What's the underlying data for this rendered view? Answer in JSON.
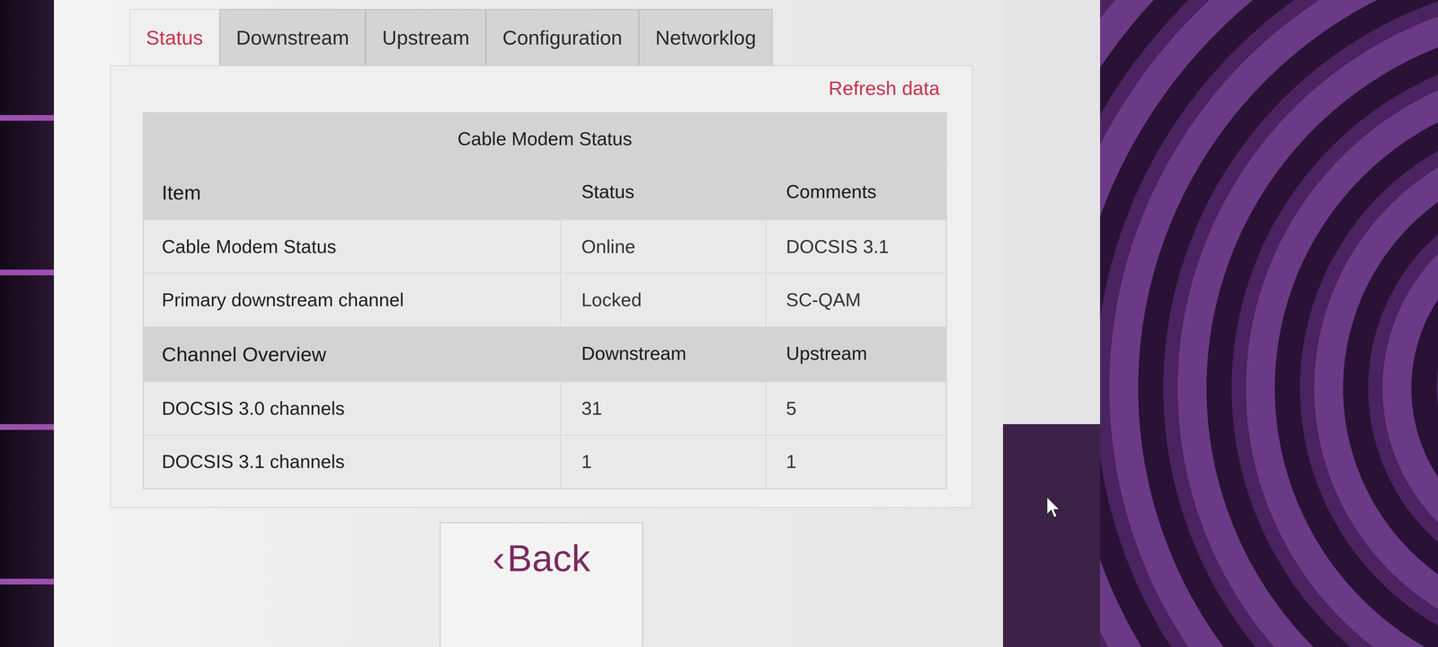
{
  "tabs": [
    {
      "label": "Status",
      "selected": true
    },
    {
      "label": "Downstream",
      "selected": false
    },
    {
      "label": "Upstream",
      "selected": false
    },
    {
      "label": "Configuration",
      "selected": false
    },
    {
      "label": "Networklog",
      "selected": false
    }
  ],
  "refresh": {
    "label": "Refresh data"
  },
  "table": {
    "title": "Cable Modem Status",
    "columns": [
      "Item",
      "Status",
      "Comments"
    ],
    "rows": [
      [
        "Cable Modem Status",
        "Online",
        "DOCSIS 3.1"
      ],
      [
        "Primary downstream channel",
        "Locked",
        "SC-QAM"
      ]
    ],
    "overview_columns": [
      "Channel Overview",
      "Downstream",
      "Upstream"
    ],
    "overview_rows": [
      [
        "DOCSIS 3.0 channels",
        "31",
        "5"
      ],
      [
        "DOCSIS 3.1 channels",
        "1",
        "1"
      ]
    ]
  },
  "back_button": {
    "icon": "‹",
    "label": "Back"
  }
}
